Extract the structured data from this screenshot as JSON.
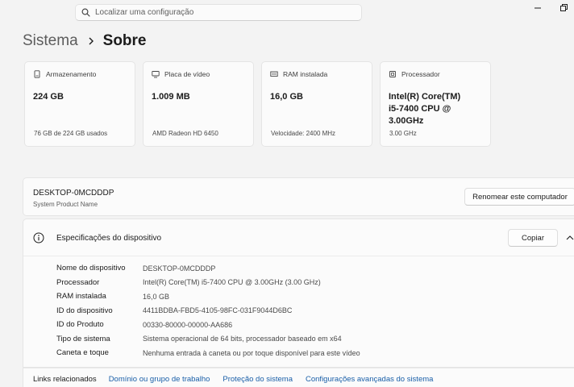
{
  "search": {
    "placeholder": "Localizar uma configuração"
  },
  "breadcrumb": {
    "parent": "Sistema",
    "current": "Sobre"
  },
  "cards": [
    {
      "label": "Armazenamento",
      "value": "224 GB",
      "sub": "76 GB de 224 GB usados",
      "icon": "storage-icon"
    },
    {
      "label": "Placa de vídeo",
      "value": "1.009 MB",
      "sub": "AMD Radeon HD 6450",
      "icon": "display-icon"
    },
    {
      "label": "RAM instalada",
      "value": "16,0 GB",
      "sub": "Velocidade: 2400 MHz",
      "icon": "ram-icon"
    },
    {
      "label": "Processador",
      "value": "Intel(R) Core(TM) i5-7400 CPU @ 3.00GHz",
      "sub": "3.00 GHz",
      "icon": "processor-icon"
    }
  ],
  "device": {
    "name": "DESKTOP-0MCDDDP",
    "model": "System Product Name",
    "rename_label": "Renomear este computador"
  },
  "specs": {
    "title": "Especificações do dispositivo",
    "copy_label": "Copiar",
    "rows": [
      {
        "key": "Nome do dispositivo",
        "value": "DESKTOP-0MCDDDP"
      },
      {
        "key": "Processador",
        "value": "Intel(R) Core(TM) i5-7400 CPU @ 3.00GHz (3.00 GHz)"
      },
      {
        "key": "RAM instalada",
        "value": "16,0 GB"
      },
      {
        "key": "ID do dispositivo",
        "value": "4411BDBA-FBD5-4105-98FC-031F9044D6BC"
      },
      {
        "key": "ID do Produto",
        "value": "00330-80000-00000-AA686"
      },
      {
        "key": "Tipo de sistema",
        "value": "Sistema operacional de 64 bits, processador baseado em x64"
      },
      {
        "key": "Caneta e toque",
        "value": "Nenhuma entrada à caneta ou por toque disponível para este vídeo"
      }
    ]
  },
  "related": {
    "label": "Links relacionados",
    "links": [
      "Domínio ou grupo de trabalho",
      "Proteção do sistema",
      "Configurações avançadas do sistema"
    ]
  },
  "colors": {
    "accent_link": "#1a5fa8",
    "background": "#f3f3f3",
    "card": "#fbfbfb"
  }
}
